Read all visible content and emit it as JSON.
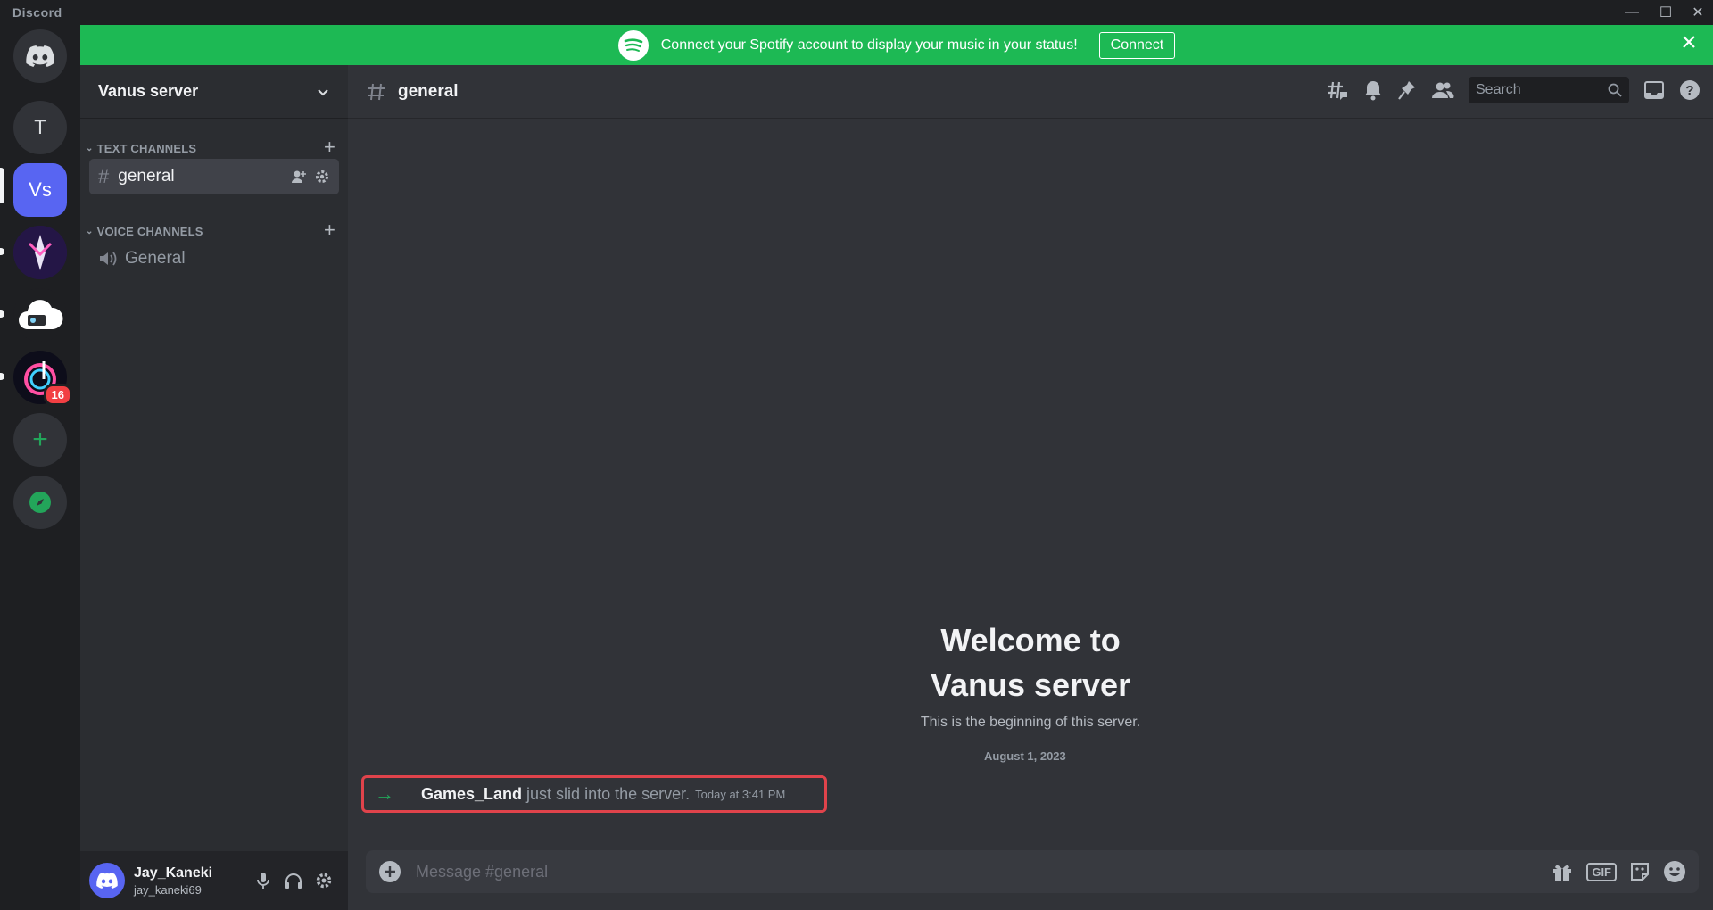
{
  "app": {
    "name": "Discord"
  },
  "window_controls": {
    "minimize": "—",
    "maximize": "☐",
    "close": "✕"
  },
  "servers": [
    {
      "label": "",
      "icon": "discord-home-icon"
    },
    {
      "label": "T"
    },
    {
      "label": "Vs",
      "selected": true
    },
    {
      "label": "",
      "icon": "anime-server-icon"
    },
    {
      "label": "",
      "icon": "cloud-server-icon"
    },
    {
      "label": "",
      "icon": "music-server-icon",
      "badge": "16"
    },
    {
      "label": "+",
      "icon": "add-server-icon"
    },
    {
      "label": "",
      "icon": "explore-compass-icon"
    }
  ],
  "banner": {
    "text": "Connect your Spotify account to display your music in your status!",
    "button": "Connect",
    "close": "✕"
  },
  "sidebar": {
    "server_name": "Vanus server",
    "categories": [
      {
        "name": "TEXT CHANNELS",
        "channels": [
          {
            "name": "general",
            "prefix": "#",
            "active": true
          }
        ]
      },
      {
        "name": "VOICE CHANNELS",
        "channels": [
          {
            "name": "General",
            "prefix": "🔊"
          }
        ]
      }
    ]
  },
  "user": {
    "name": "Jay_Kaneki",
    "handle": "jay_kaneki69"
  },
  "chat": {
    "channel_name": "general",
    "search_placeholder": "Search",
    "welcome_title_line1": "Welcome to",
    "welcome_title_line2": "Vanus server",
    "welcome_subtitle": "This is the beginning of this server.",
    "date_divider": "August 1, 2023",
    "join_message": {
      "user": "Games_Land",
      "text": "just slid into the server.",
      "time": "Today at 3:41 PM"
    },
    "composer_placeholder": "Message #general",
    "gif_label": "GIF"
  },
  "colors": {
    "banner_green": "#1db954",
    "blurple": "#5865f2",
    "badge_red": "#f23f43",
    "highlight_red": "#e0434b"
  }
}
